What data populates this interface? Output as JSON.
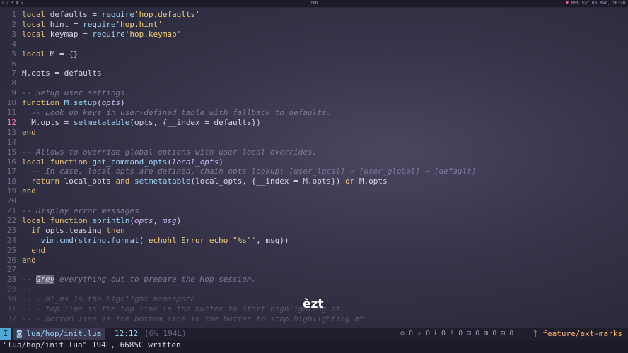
{
  "topbar": {
    "workspaces": [
      "1",
      "2",
      "3",
      "4",
      "5"
    ],
    "title": "zsh",
    "status_left": "♥",
    "status_battery": "85%",
    "status_datetime": "Sat 06 Mar, 16:20"
  },
  "code_lines": [
    {
      "n": "1",
      "t": "local defaults = require'hop.defaults'"
    },
    {
      "n": "2",
      "t": "local hint = require'hop.hint'"
    },
    {
      "n": "3",
      "t": "local keymap = require'hop.keymap'"
    },
    {
      "n": "4",
      "t": ""
    },
    {
      "n": "5",
      "t": "local M = {}"
    },
    {
      "n": "6",
      "t": ""
    },
    {
      "n": "7",
      "t": "M.opts = defaults"
    },
    {
      "n": "8",
      "t": ""
    },
    {
      "n": "9",
      "t": "-- Setup user settings."
    },
    {
      "n": "10",
      "t": "function M.setup(opts)"
    },
    {
      "n": "11",
      "t": "  -- Look up keys in user-defined table with fallback to defaults."
    },
    {
      "n": "12",
      "t": "  M.opts = setmetatable(opts, {__index = defaults})"
    },
    {
      "n": "13",
      "t": "end"
    },
    {
      "n": "14",
      "t": ""
    },
    {
      "n": "15",
      "t": "-- Allows to override global options with user local overrides."
    },
    {
      "n": "16",
      "t": "local function get_command_opts(local_opts)"
    },
    {
      "n": "17",
      "t": "  -- In case, local opts are defined, chain opts lookup: [user_local] → [user_global] → [default]"
    },
    {
      "n": "18",
      "t": "  return local_opts and setmetatable(local_opts, {__index = M.opts}) or M.opts"
    },
    {
      "n": "19",
      "t": "end"
    },
    {
      "n": "20",
      "t": ""
    },
    {
      "n": "21",
      "t": "-- Display error messages."
    },
    {
      "n": "22",
      "t": "local function eprintln(opts, msg)"
    },
    {
      "n": "23",
      "t": "  if opts.teasing then"
    },
    {
      "n": "24",
      "t": "    vim.cmd(string.format('echohl Error|echo \"%s\"', msg))"
    },
    {
      "n": "25",
      "t": "  end"
    },
    {
      "n": "26",
      "t": "end"
    },
    {
      "n": "27",
      "t": ""
    },
    {
      "n": "28",
      "t": "-- Grey everything out to prepare the Hop session."
    },
    {
      "n": "29",
      "t": "--"
    },
    {
      "n": "30",
      "t": "-- - hl_ns is the highlight namespace."
    },
    {
      "n": "31",
      "t": "-- - top_line is the top line in the buffer to start highlighting at"
    },
    {
      "n": "32",
      "t": "-- - bottom_line is the bottom line in the buffer to stop highlighting at"
    }
  ],
  "overlay_text": "èzt",
  "statusline": {
    "mode": "I",
    "filename": "lua/hop/init.lua",
    "position": "12:12",
    "percent": "(6% 194L)",
    "diagnostics": "⊘ 0 ⚠ 0 ℹ 0 ! 0 ⊡ 0 ⊞ 0 ⊟ 0",
    "branch": "feature/ext-marks"
  },
  "cmdline": "\"lua/hop/init.lua\" 194L, 6685C written",
  "colors": {
    "background": "#2b2a3d",
    "keyword": "#e5c07b",
    "string": "#f3d27a",
    "function": "#9bd2f2",
    "comment": "#7d7896",
    "current_line_number": "#ff7ab8",
    "branch": "#ffb066"
  }
}
